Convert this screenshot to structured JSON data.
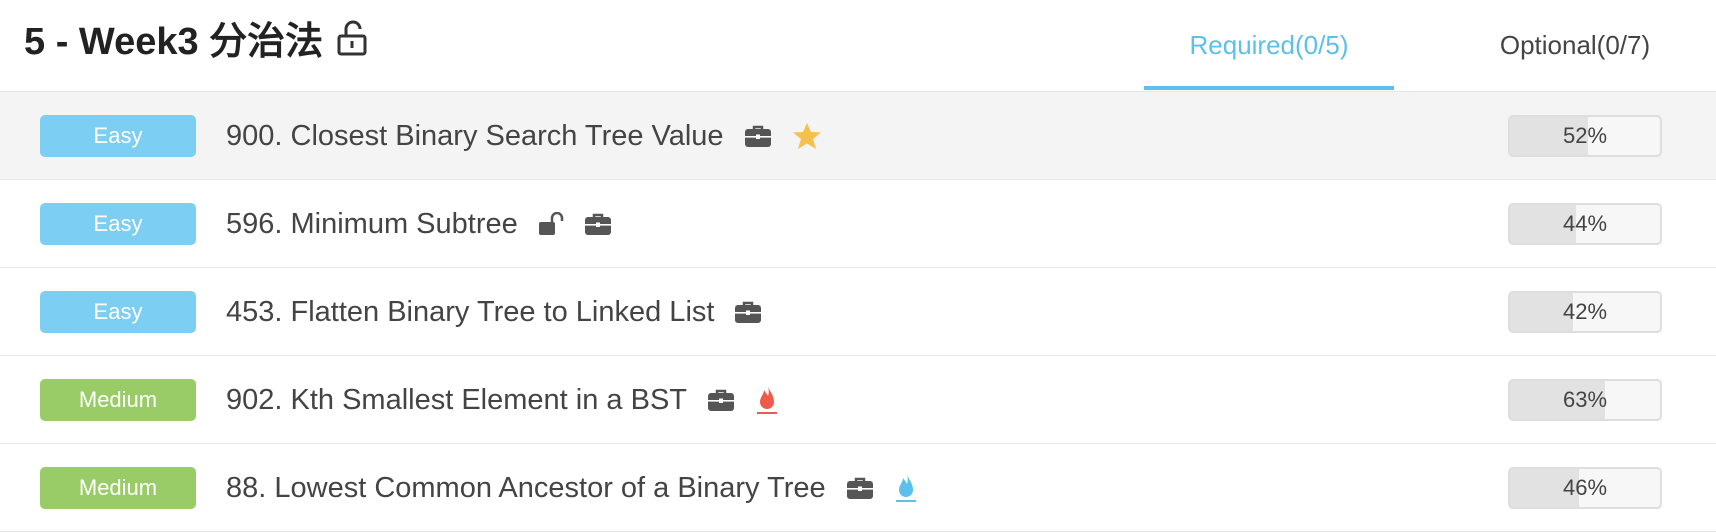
{
  "header": {
    "title": "5 - Week3 分治法",
    "tabs": [
      {
        "label": "Required(0/5)",
        "active": true
      },
      {
        "label": "Optional(0/7)",
        "active": false
      }
    ]
  },
  "colors": {
    "accent": "#5bc0eb",
    "easy": "#7ccff2",
    "medium": "#99cc66",
    "star": "#f5c04f",
    "fire_red": "#ef5b4b",
    "fire_blue": "#5bc0eb"
  },
  "problems": [
    {
      "difficulty": "Easy",
      "title": "900. Closest Binary Search Tree Value",
      "icons": [
        "briefcase-icon",
        "star-icon"
      ],
      "rate": "52%",
      "rate_value": 52
    },
    {
      "difficulty": "Easy",
      "title": "596. Minimum Subtree",
      "icons": [
        "unlock-icon",
        "briefcase-icon"
      ],
      "rate": "44%",
      "rate_value": 44
    },
    {
      "difficulty": "Easy",
      "title": "453. Flatten Binary Tree to Linked List",
      "icons": [
        "briefcase-icon"
      ],
      "rate": "42%",
      "rate_value": 42
    },
    {
      "difficulty": "Medium",
      "title": "902. Kth Smallest Element in a BST",
      "icons": [
        "briefcase-icon",
        "fire-red-icon"
      ],
      "rate": "63%",
      "rate_value": 63
    },
    {
      "difficulty": "Medium",
      "title": "88. Lowest Common Ancestor of a Binary Tree",
      "icons": [
        "briefcase-icon",
        "fire-blue-icon"
      ],
      "rate": "46%",
      "rate_value": 46
    }
  ]
}
